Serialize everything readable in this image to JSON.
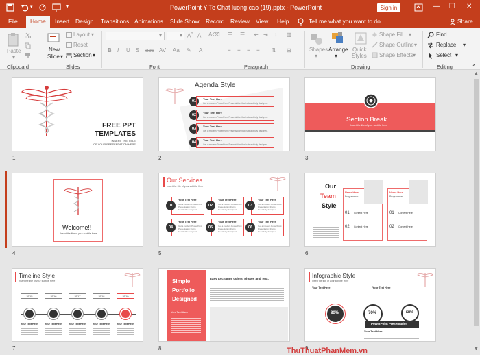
{
  "window": {
    "title": "PowerPoint Y Te Chat luong cao (19).pptx  -  PowerPoint",
    "sign_in": "Sign in",
    "share": "Share"
  },
  "tabs": [
    "File",
    "Home",
    "Insert",
    "Design",
    "Transitions",
    "Animations",
    "Slide Show",
    "Record",
    "Review",
    "View",
    "Help"
  ],
  "tell_me": "Tell me what you want to do",
  "ribbon": {
    "clipboard": {
      "group": "Clipboard",
      "paste": "Paste"
    },
    "slides": {
      "group": "Slides",
      "new_slide": "New",
      "new_slide2": "Slide",
      "layout": "Layout",
      "reset": "Reset",
      "section": "Section"
    },
    "font": {
      "group": "Font"
    },
    "paragraph": {
      "group": "Paragraph"
    },
    "drawing": {
      "group": "Drawing",
      "shapes": "Shapes",
      "arrange": "Arrange",
      "quick1": "Quick",
      "quick2": "Styles",
      "shape_fill": "Shape Fill",
      "shape_outline": "Shape Outline",
      "shape_effects": "Shape Effects"
    },
    "editing": {
      "group": "Editing",
      "find": "Find",
      "replace": "Replace",
      "select": "Select"
    }
  },
  "slides": [
    {
      "num": "1",
      "title1": "FREE PPT",
      "title2": "TEMPLATES",
      "sub1": "INSERT THE TITLE",
      "sub2": "OF YOUR PRESENTATION HERE"
    },
    {
      "num": "2",
      "title": "Agenda Style",
      "items": [
        "01",
        "02",
        "03",
        "04"
      ],
      "item_title": "Your Text Here",
      "item_body": "Get a modern PowerPoint  Presentation that is beautifully designed."
    },
    {
      "num": "3",
      "title": "Section Break",
      "sub": "Insert the title of your subtitle Here"
    },
    {
      "num": "4",
      "title": "Welcome!!",
      "sub": "Insert the title of your subtitle Here"
    },
    {
      "num": "5",
      "title": "Our Services",
      "sub": "Insert the title of your subtitle Here",
      "items": [
        "01",
        "02",
        "03",
        "04",
        "05",
        "06"
      ],
      "item_title": "Your Text Here",
      "item_body": "Get a modern PowerPoint Presentation that is beautifully designed."
    },
    {
      "num": "6",
      "t1": "Our",
      "t2": "Team",
      "t3": "Style",
      "name": "Name Here",
      "role": "Programmer",
      "content": "Content Here",
      "n1": "01",
      "n2": "02"
    },
    {
      "num": "7",
      "title": "Timeline Style",
      "sub": "Insert the title of your subtitle Here",
      "years": [
        "2015",
        "2016",
        "2017",
        "2018",
        "2019"
      ],
      "item_title": "Your Text Here"
    },
    {
      "num": "8",
      "t1": "Simple",
      "t2": "Portfolio",
      "t3": "Designed",
      "head": "Easy to change colors, photos and Text.",
      "item_title": "Your Text Here"
    },
    {
      "num": "9",
      "title": "Infographic Style",
      "sub": "Insert the title of your subtitle Here",
      "p1": "80%",
      "p2": "70%",
      "p3": "60%",
      "banner": "PowerPoint Presentation",
      "item_title": "Your Text Here"
    }
  ],
  "watermark": "ThuThuatPhanMem.vn"
}
